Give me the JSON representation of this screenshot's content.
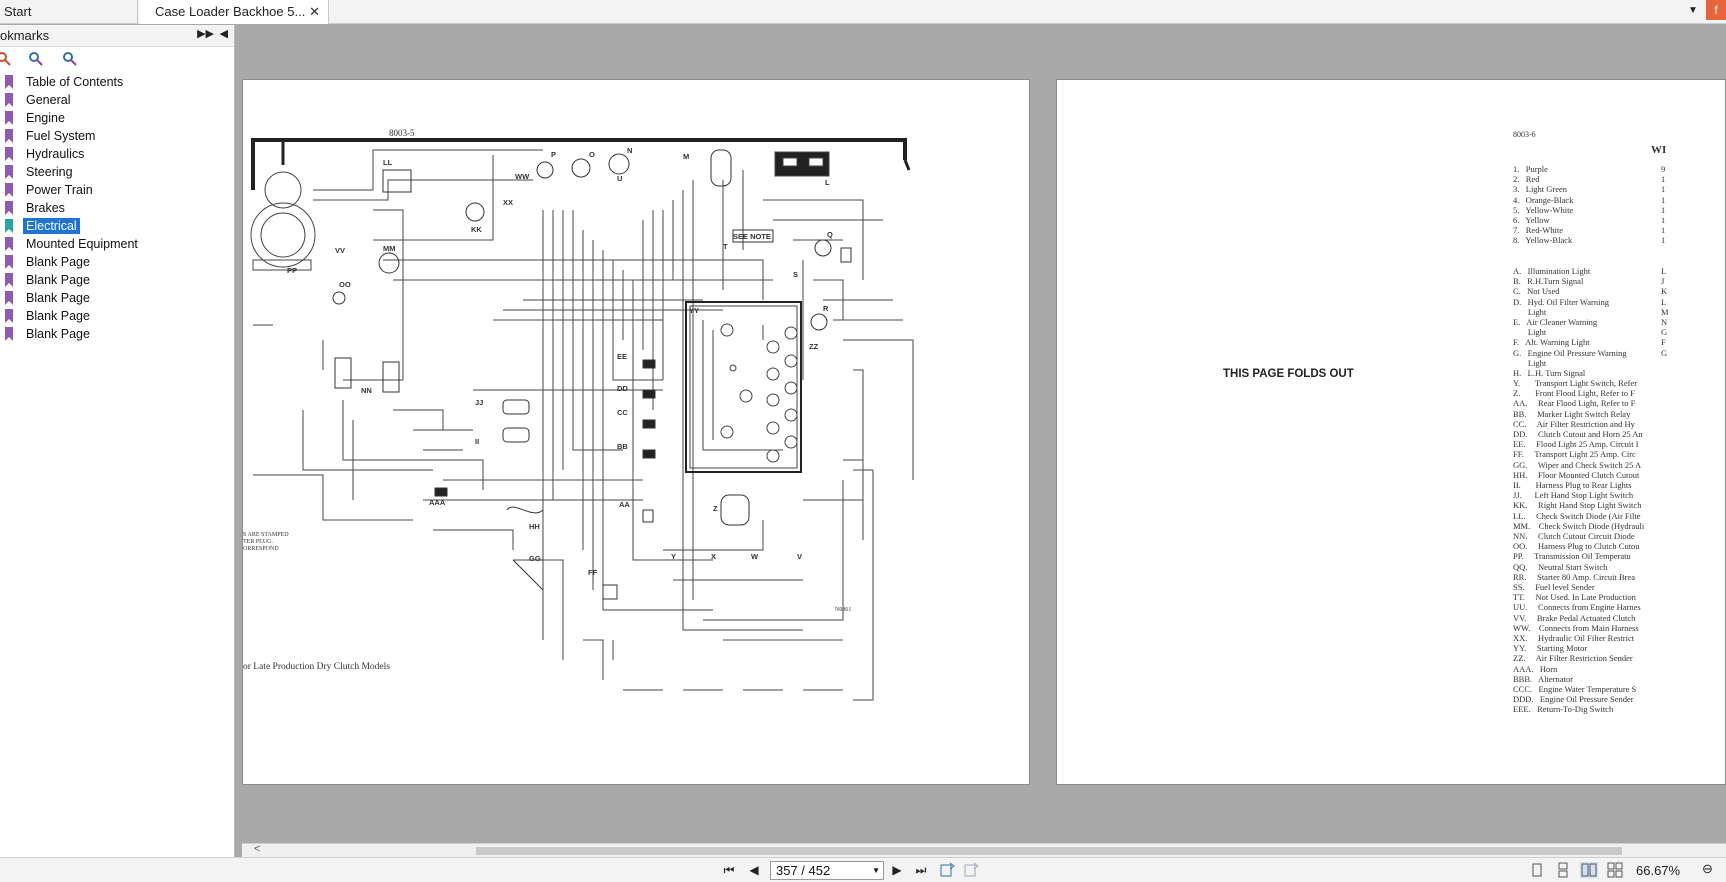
{
  "tabs": {
    "start": "Start",
    "doc": "Case Loader Backhoe 5...",
    "close": "✕"
  },
  "bookmarks": {
    "title": "okmarks",
    "items": [
      "Table of Contents",
      "General",
      "Engine",
      "Fuel System",
      "Hydraulics",
      "Steering",
      "Power Train",
      "Brakes",
      "Electrical",
      "Mounted Equipment",
      "Blank Page",
      "Blank Page",
      "Blank Page",
      "Blank Page",
      "Blank Page"
    ],
    "selected_index": 8
  },
  "left_page": {
    "header": "8003-5",
    "caption": "or Late Production Dry Clutch Models",
    "side_note": [
      "S ARE STAMPED",
      "TER PLUG.",
      "ORRESPOND"
    ],
    "drawing_no": "N0861",
    "labels": [
      "PP",
      "LL",
      "VV",
      "MM",
      "OO",
      "NN",
      "KK",
      "XX",
      "WW",
      "P",
      "O",
      "N",
      "U",
      "M",
      "L",
      "T",
      "SEE NOTE",
      "S",
      "Q",
      "R",
      "ZZ",
      "YY",
      "EE",
      "DD",
      "CC",
      "BB",
      "JJ",
      "II",
      "AAA",
      "HH",
      "GG",
      "FF",
      "AA",
      "Z",
      "Y",
      "X",
      "W",
      "V"
    ]
  },
  "right_page": {
    "header": "8003-6",
    "heading_partial": "WI",
    "fold_text": "THIS PAGE FOLDS OUT",
    "colors": [
      "1.   Purple",
      "2.   Red",
      "3.   Light Green",
      "4.   Orange-Black",
      "5.   Yellow-White",
      "6.   Yellow",
      "7.   Red-White",
      "8.   Yellow-Black"
    ],
    "colors_right_col": [
      "9",
      "1",
      "1",
      "1",
      "1",
      "1",
      "1",
      "1"
    ],
    "lights": [
      "A.   Illumination Light",
      "B.   R.H.Turn Signal",
      "C.   Not Used",
      "D.   Hyd. Oil Filter Warning",
      "       Light",
      "E.   Air Cleaner Warning",
      "       Light",
      "F.   Alt. Warning Light",
      "G.   Engine Oil Pressure Warning",
      "       Light",
      "H.   L.H. Turn Signal"
    ],
    "lights_right_col": [
      "L",
      "J",
      "K",
      "L",
      "M",
      "N",
      "G",
      "F",
      "G",
      "",
      ""
    ],
    "components": [
      "Y.       Transport Light Switch, Refer",
      "Z.       Front Flood Light, Refer to F",
      "AA.     Rear Flood Light, Refer to F",
      "BB.     Marker Light Switch Relay",
      "CC.     Air Filter Restriction and Hy",
      "DD.     Clutch Cutout and Horn 25 An",
      "EE.     Flood Light 25 Amp. Circuit I",
      "FF.     Transport Light 25 Amp. Circ",
      "GG.     Wiper and Check Switch 25 A",
      "HH.     Floor Mounted Clutch Cutout",
      "II.       Harness Plug to Rear Lights",
      "JJ.      Left Hand Stop Light Switch",
      "KK.     Right Hand Stop Light Switch",
      "LL.     Check Switch Diode (Air Filte",
      "MM.    Check Switch Diode (Hydrauli",
      "NN.     Clutch Cutout Circuit Diode",
      "OO.     Harness Plug to Clutch Cutou",
      "PP.     Transmission Oil Temperatu",
      "QQ.     Neutral Start Switch",
      "RR.     Starter 80 Amp. Circuit Brea",
      "SS.     Fuel level Sender",
      "TT.     Not Used. In Late Production",
      "UU.     Connects from Engine Harnes",
      "VV.     Brake Pedal Actuated Clutch",
      "WW.    Connects from Main Harness",
      "XX.     Hydraulic Oil Filter Restrict",
      "YY.     Starting Motor",
      "ZZ.     Air Filter Restriction Sender",
      "AAA.   Horn",
      "BBB.   Alternator",
      "CCC.   Engine Water Temperature S",
      "DDD.   Engine Oil Pressure Sender",
      "EEE.   Return-To-Dig Switch"
    ]
  },
  "statusbar": {
    "page_indicator": "357 / 452",
    "zoom": "66.67%"
  },
  "icons": {
    "first": "first-page-icon",
    "prev": "prev-page-icon",
    "next": "next-page-icon",
    "last": "last-page-icon"
  }
}
